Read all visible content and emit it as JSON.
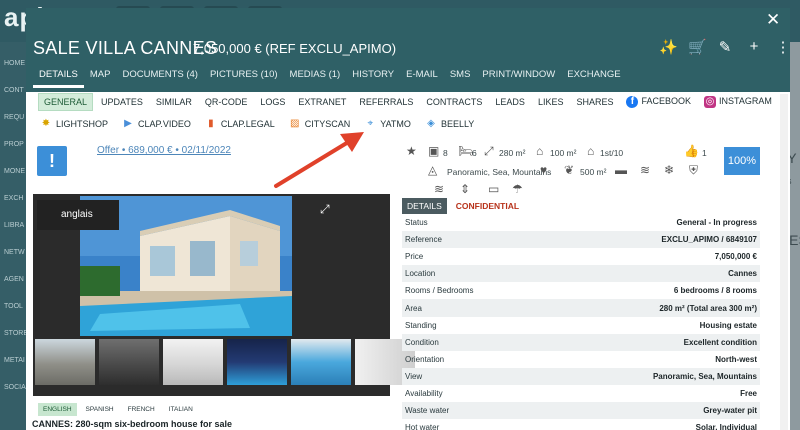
{
  "app": {
    "logo": "apimo",
    "side_items": [
      "HOME",
      "CONT",
      "REQU",
      "PROP",
      "MONE",
      "EXCH",
      "LIBRA",
      "NETW",
      "AGEN",
      "TOOL",
      "STORE",
      "METAI",
      "SOCIA"
    ],
    "right_fragments": [
      "AY",
      "res",
      "RES"
    ]
  },
  "header": {
    "title": "SALE VILLA CANNES",
    "price_ref": "7,050,000 € (REF EXCLU_APIMO)",
    "close": "✕",
    "actions": [
      {
        "name": "magic-wand-icon",
        "glyph": "✨"
      },
      {
        "name": "cart-icon",
        "glyph": "🛒"
      },
      {
        "name": "edit-icon",
        "glyph": "✎"
      },
      {
        "name": "add-icon",
        "glyph": "+"
      },
      {
        "name": "more-icon",
        "glyph": "⋮"
      }
    ],
    "tabs": [
      "DETAILS",
      "MAP",
      "DOCUMENTS (4)",
      "PICTURES (10)",
      "MEDIAS (1)",
      "HISTORY",
      "E-MAIL",
      "SMS",
      "PRINT/WINDOW",
      "EXCHANGE"
    ]
  },
  "subtabs": [
    "GENERAL",
    "UPDATES",
    "SIMILAR",
    "QR-CODE",
    "LOGS",
    "EXTRANET",
    "REFERRALS",
    "CONTRACTS",
    "LEADS",
    "LIKES",
    "SHARES",
    "FACEBOOK",
    "INSTAGRAM"
  ],
  "subtabs2": [
    {
      "label": "LIGHTSHOP",
      "icon": "lightshop-icon",
      "color": "#d9a400"
    },
    {
      "label": "CLAP.VIDEO",
      "icon": "clap-video-icon",
      "color": "#4a8fd9"
    },
    {
      "label": "CLAP.LEGAL",
      "icon": "clap-legal-icon",
      "color": "#e05a2b"
    },
    {
      "label": "CITYSCAN",
      "icon": "cityscan-icon",
      "color": "#e87a1e"
    },
    {
      "label": "YATMO",
      "icon": "map-pin-icon",
      "color": "#3c8fd8"
    },
    {
      "label": "BEELLY",
      "icon": "beelly-icon",
      "color": "#3c8fd8"
    }
  ],
  "alert_glyph": "!",
  "offer_link": "Offer • 689,000 € • 02/11/2022",
  "photo": {
    "lang_badge": "anglais",
    "languages": [
      "ENGLISH",
      "SPANISH",
      "FRENCH",
      "ITALIAN"
    ],
    "description_title": "CANNES: 280-sqm six-bedroom house for sale"
  },
  "features": {
    "rooms": "8",
    "bedrooms": "6",
    "area": "280 m²",
    "land": "100 m²",
    "floor": "1st/10",
    "likes": "1",
    "view": "Panoramic, Sea, Mountains",
    "plot": "500 m²",
    "percent": "100%"
  },
  "details_tabs": [
    "DETAILS",
    "CONFIDENTIAL"
  ],
  "details": [
    {
      "label": "Status",
      "value": "General - In progress"
    },
    {
      "label": "Reference",
      "value": "EXCLU_APIMO / 6849107"
    },
    {
      "label": "Price",
      "value": "7,050,000 €"
    },
    {
      "label": "Location",
      "value": "Cannes"
    },
    {
      "label": "Rooms / Bedrooms",
      "value": "6 bedrooms / 8 rooms"
    },
    {
      "label": "Area",
      "value": "280 m² (Total area 300 m²)"
    },
    {
      "label": "Standing",
      "value": "Housing estate"
    },
    {
      "label": "Condition",
      "value": "Excellent condition"
    },
    {
      "label": "Orientation",
      "value": "North-west"
    },
    {
      "label": "View",
      "value": "Panoramic, Sea, Mountains"
    },
    {
      "label": "Availability",
      "value": "Free"
    },
    {
      "label": "Waste water",
      "value": "Grey-water pit"
    },
    {
      "label": "Hot water",
      "value": "Solar, Individual"
    }
  ],
  "colors": {
    "header": "#2f6066",
    "accent_blue": "#3c8fd8",
    "arrow": "#e0412a",
    "confidential": "#b8331b"
  }
}
